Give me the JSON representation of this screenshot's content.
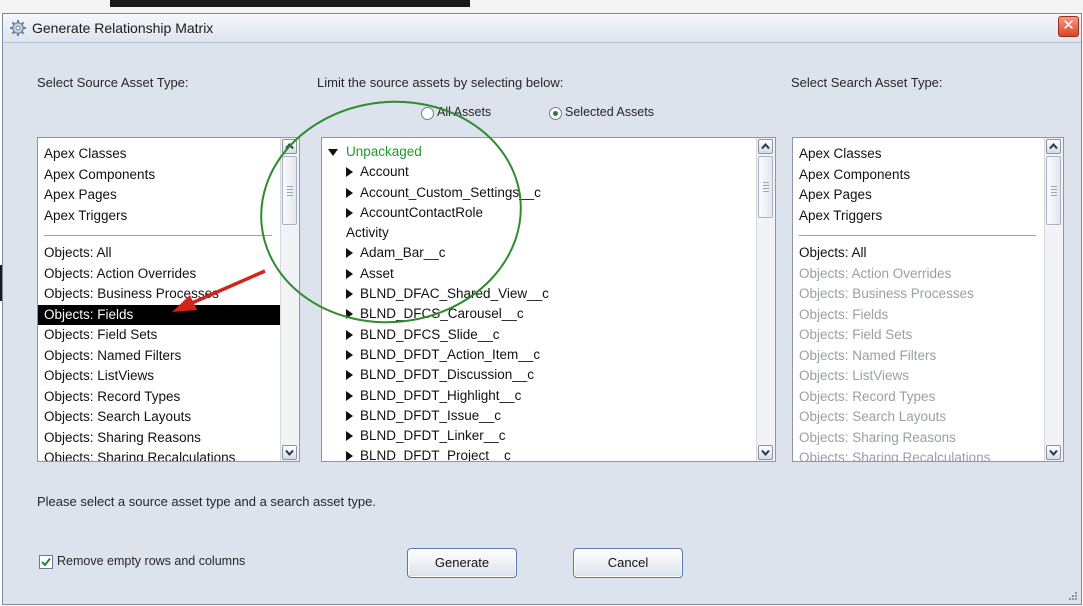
{
  "dialog": {
    "title": "Generate Relationship Matrix",
    "close_label": "✕"
  },
  "source": {
    "label": "Select Source Asset Type:",
    "group1": [
      "Apex Classes",
      "Apex Components",
      "Apex Pages",
      "Apex Triggers"
    ],
    "group2": [
      "Objects: All",
      "Objects: Action Overrides",
      "Objects: Business Processes",
      "Objects: Fields",
      "Objects: Field Sets",
      "Objects: Named Filters",
      "Objects: ListViews",
      "Objects: Record Types",
      "Objects: Search Layouts",
      "Objects: Sharing Reasons",
      "Objects: Sharing Recalculations"
    ],
    "selected": "Objects: Fields"
  },
  "limit": {
    "label": "Limit the source assets by selecting below:",
    "radio_all": "All Assets",
    "radio_selected": "Selected Assets",
    "selected_option": "Selected Assets",
    "root": "Unpackaged",
    "items": [
      {
        "text": "Account",
        "arrow": true
      },
      {
        "text": "Account_Custom_Settings__c",
        "arrow": true
      },
      {
        "text": "AccountContactRole",
        "arrow": true
      },
      {
        "text": "Activity",
        "arrow": false
      },
      {
        "text": "Adam_Bar__c",
        "arrow": true
      },
      {
        "text": "Asset",
        "arrow": true
      },
      {
        "text": "BLND_DFAC_Shared_View__c",
        "arrow": true
      },
      {
        "text": "BLND_DFCS_Carousel__c",
        "arrow": true
      },
      {
        "text": "BLND_DFCS_Slide__c",
        "arrow": true
      },
      {
        "text": "BLND_DFDT_Action_Item__c",
        "arrow": true
      },
      {
        "text": "BLND_DFDT_Discussion__c",
        "arrow": true
      },
      {
        "text": "BLND_DFDT_Highlight__c",
        "arrow": true
      },
      {
        "text": "BLND_DFDT_Issue__c",
        "arrow": true
      },
      {
        "text": "BLND_DFDT_Linker__c",
        "arrow": true
      },
      {
        "text": "BLND_DFDT_Project__c",
        "arrow": true
      }
    ]
  },
  "search": {
    "label": "Select Search Asset Type:",
    "group1": [
      "Apex Classes",
      "Apex Components",
      "Apex Pages",
      "Apex Triggers"
    ],
    "group2_enabled": [
      "Objects: All"
    ],
    "group2_disabled": [
      "Objects: Action Overrides",
      "Objects: Business Processes",
      "Objects: Fields",
      "Objects: Field Sets",
      "Objects: Named Filters",
      "Objects: ListViews",
      "Objects: Record Types",
      "Objects: Search Layouts",
      "Objects: Sharing Reasons",
      "Objects: Sharing Recalculations"
    ]
  },
  "status_message": "Please select a source asset type and a search asset type.",
  "remove_empty": {
    "label": "Remove empty rows and columns",
    "checked": true
  },
  "buttons": {
    "generate": "Generate",
    "cancel": "Cancel"
  },
  "colors": {
    "tree_root": "#1f9a2a",
    "annotation_circle": "#2e8b2e",
    "annotation_arrow": "#d0251d",
    "selected_bg": "#000000"
  }
}
